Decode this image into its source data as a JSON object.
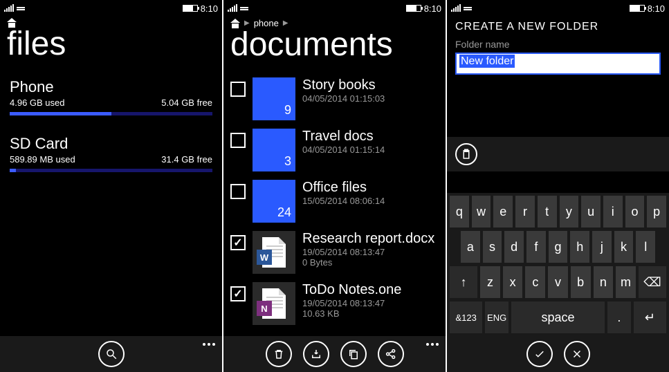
{
  "status": {
    "time": "8:10"
  },
  "panel1": {
    "title": "files",
    "storages": [
      {
        "name": "Phone",
        "used": "4.96 GB used",
        "free": "5.04 GB free",
        "fill_pct": 50
      },
      {
        "name": "SD Card",
        "used": "589.89 MB used",
        "free": "31.4 GB free",
        "fill_pct": 3
      }
    ]
  },
  "panel2": {
    "breadcrumb": "phone",
    "title": "documents",
    "items": [
      {
        "type": "folder",
        "checked": false,
        "name": "Story books",
        "meta": "04/05/2014 01:15:03",
        "count": "9"
      },
      {
        "type": "folder",
        "checked": false,
        "name": "Travel docs",
        "meta": "04/05/2014 01:15:14",
        "count": "3"
      },
      {
        "type": "folder",
        "checked": false,
        "name": "Office files",
        "meta": "15/05/2014 08:06:14",
        "count": "24"
      },
      {
        "type": "file",
        "checked": true,
        "name": "Research report.docx",
        "meta": "19/05/2014 08:13:47",
        "size": "0 Bytes",
        "app": "W",
        "app_color": "#2b579a"
      },
      {
        "type": "file",
        "checked": true,
        "name": "ToDo Notes.one",
        "meta": "19/05/2014 08:13:47",
        "size": "10.63 KB",
        "app": "N",
        "app_color": "#7d2f7e"
      }
    ]
  },
  "panel3": {
    "heading": "CREATE A NEW FOLDER",
    "field_label": "Folder name",
    "field_value": "New folder",
    "keyboard": {
      "r1": [
        "q",
        "w",
        "e",
        "r",
        "t",
        "y",
        "u",
        "i",
        "o",
        "p"
      ],
      "r2": [
        "a",
        "s",
        "d",
        "f",
        "g",
        "h",
        "j",
        "k",
        "l"
      ],
      "r3_shift": "↑",
      "r3": [
        "z",
        "x",
        "c",
        "v",
        "b",
        "n",
        "m"
      ],
      "r3_back": "⌫",
      "r4_sym": "&123",
      "r4_lang": "ENG",
      "r4_space": "space",
      "r4_dot": ".",
      "r4_enter": "↵"
    }
  }
}
